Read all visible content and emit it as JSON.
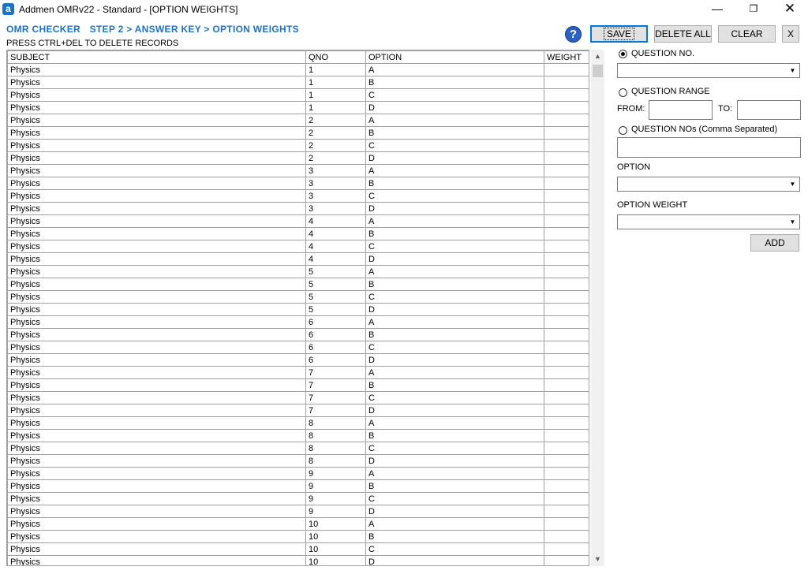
{
  "window": {
    "title": "Addmen OMRv22 - Standard - [OPTION WEIGHTS]",
    "app_icon_letter": "a",
    "minimize": "—",
    "maximize": "❐",
    "close": "✕"
  },
  "header": {
    "breadcrumb": [
      "OMR CHECKER",
      "STEP 2 > ANSWER KEY > OPTION WEIGHTS"
    ],
    "hint": "PRESS CTRL+DEL TO DELETE RECORDS"
  },
  "toolbar": {
    "help_label": "?",
    "save_label": "SAVE",
    "delete_all_label": "DELETE ALL",
    "clear_label": "CLEAR",
    "close_label": "X"
  },
  "table": {
    "columns": [
      "SUBJECT",
      "QNO",
      "OPTION",
      "WEIGHT"
    ],
    "rows": [
      [
        "Physics",
        "1",
        "A",
        ""
      ],
      [
        "Physics",
        "1",
        "B",
        ""
      ],
      [
        "Physics",
        "1",
        "C",
        ""
      ],
      [
        "Physics",
        "1",
        "D",
        ""
      ],
      [
        "Physics",
        "2",
        "A",
        ""
      ],
      [
        "Physics",
        "2",
        "B",
        ""
      ],
      [
        "Physics",
        "2",
        "C",
        ""
      ],
      [
        "Physics",
        "2",
        "D",
        ""
      ],
      [
        "Physics",
        "3",
        "A",
        ""
      ],
      [
        "Physics",
        "3",
        "B",
        ""
      ],
      [
        "Physics",
        "3",
        "C",
        ""
      ],
      [
        "Physics",
        "3",
        "D",
        ""
      ],
      [
        "Physics",
        "4",
        "A",
        ""
      ],
      [
        "Physics",
        "4",
        "B",
        ""
      ],
      [
        "Physics",
        "4",
        "C",
        ""
      ],
      [
        "Physics",
        "4",
        "D",
        ""
      ],
      [
        "Physics",
        "5",
        "A",
        ""
      ],
      [
        "Physics",
        "5",
        "B",
        ""
      ],
      [
        "Physics",
        "5",
        "C",
        ""
      ],
      [
        "Physics",
        "5",
        "D",
        ""
      ],
      [
        "Physics",
        "6",
        "A",
        ""
      ],
      [
        "Physics",
        "6",
        "B",
        ""
      ],
      [
        "Physics",
        "6",
        "C",
        ""
      ],
      [
        "Physics",
        "6",
        "D",
        ""
      ],
      [
        "Physics",
        "7",
        "A",
        ""
      ],
      [
        "Physics",
        "7",
        "B",
        ""
      ],
      [
        "Physics",
        "7",
        "C",
        ""
      ],
      [
        "Physics",
        "7",
        "D",
        ""
      ],
      [
        "Physics",
        "8",
        "A",
        ""
      ],
      [
        "Physics",
        "8",
        "B",
        ""
      ],
      [
        "Physics",
        "8",
        "C",
        ""
      ],
      [
        "Physics",
        "8",
        "D",
        ""
      ],
      [
        "Physics",
        "9",
        "A",
        ""
      ],
      [
        "Physics",
        "9",
        "B",
        ""
      ],
      [
        "Physics",
        "9",
        "C",
        ""
      ],
      [
        "Physics",
        "9",
        "D",
        ""
      ],
      [
        "Physics",
        "10",
        "A",
        ""
      ],
      [
        "Physics",
        "10",
        "B",
        ""
      ],
      [
        "Physics",
        "10",
        "C",
        ""
      ],
      [
        "Physics",
        "10",
        "D",
        ""
      ]
    ]
  },
  "panel": {
    "question_no_label": "QUESTION NO.",
    "question_no_selected": true,
    "question_range_label": "QUESTION RANGE",
    "from_label": "FROM:",
    "to_label": "TO:",
    "question_nos_label": "QUESTION NOs (Comma Separated)",
    "option_label": "OPTION",
    "option_weight_label": "OPTION WEIGHT",
    "add_label": "ADD"
  },
  "scrollbar": {
    "up_icon": "▲",
    "down_icon": "▼"
  },
  "colors": {
    "accent": "#1a73c9",
    "grid_border": "#a0a0a0",
    "button_face": "#e1e1e1",
    "focus_border": "#0078d7"
  }
}
